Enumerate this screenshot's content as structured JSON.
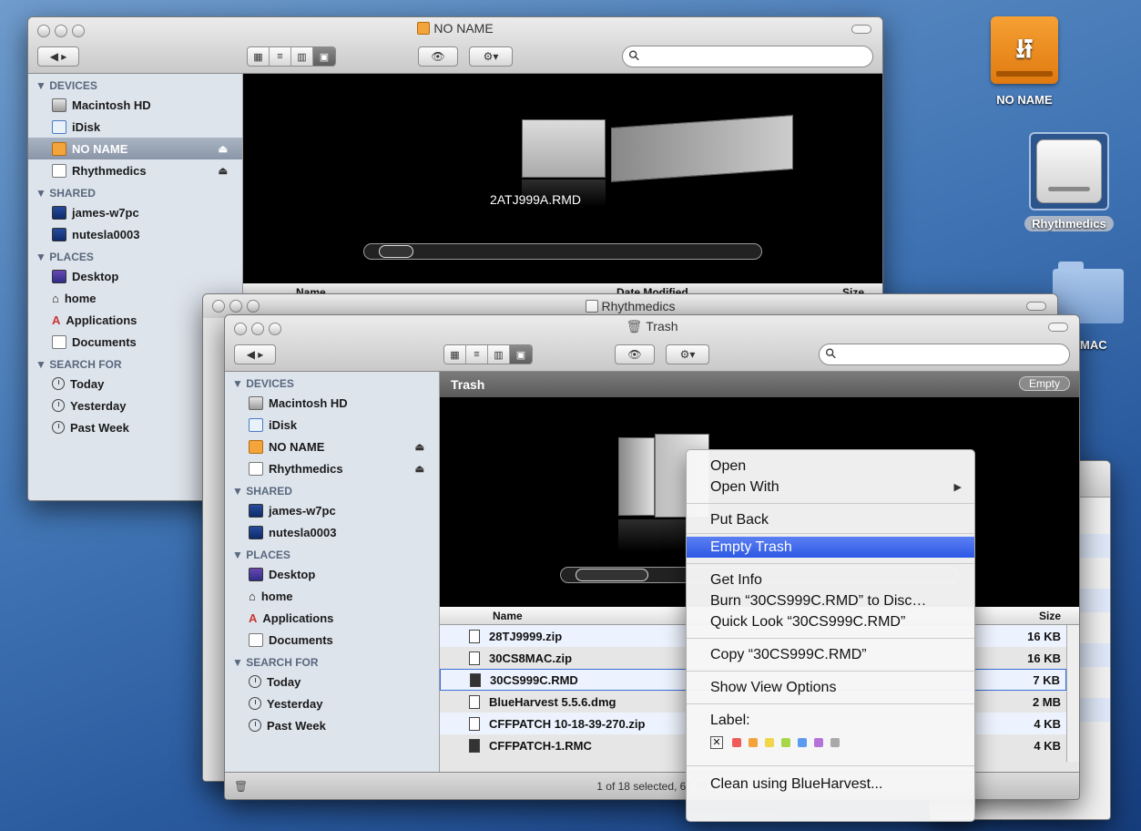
{
  "desktop": {
    "icons": [
      {
        "label": "NO NAME"
      },
      {
        "label": "Rhythmedics"
      },
      {
        "label": "MAC"
      }
    ]
  },
  "window_noname": {
    "title": "NO NAME",
    "coverflow_caption": "2ATJ999A.RMD",
    "columns": {
      "name": "Name",
      "date": "Date Modified",
      "size": "Size"
    },
    "sidebar": {
      "devices_header": "▼ DEVICES",
      "devices": [
        "Macintosh HD",
        "iDisk",
        "NO NAME",
        "Rhythmedics"
      ],
      "shared_header": "▼ SHARED",
      "shared": [
        "james-w7pc",
        "nutesla0003"
      ],
      "places_header": "▼ PLACES",
      "places": [
        "Desktop",
        "home",
        "Applications",
        "Documents"
      ],
      "search_header": "▼ SEARCH FOR",
      "search": [
        "Today",
        "Yesterday",
        "Past Week"
      ]
    }
  },
  "window_rhythmedics": {
    "title": "Rhythmedics"
  },
  "window_trash": {
    "title": "Trash",
    "path_label": "Trash",
    "empty_button": "Empty",
    "columns": {
      "name": "Name",
      "size": "Size"
    },
    "status": "1 of 18 selected, 67.59",
    "sidebar": {
      "devices_header": "▼ DEVICES",
      "devices": [
        "Macintosh HD",
        "iDisk",
        "NO NAME",
        "Rhythmedics"
      ],
      "shared_header": "▼ SHARED",
      "shared": [
        "james-w7pc",
        "nutesla0003"
      ],
      "places_header": "▼ PLACES",
      "places": [
        "Desktop",
        "home",
        "Applications",
        "Documents"
      ],
      "search_header": "▼ SEARCH FOR",
      "search": [
        "Today",
        "Yesterday",
        "Past Week"
      ]
    },
    "files": [
      {
        "name": "28TJ9999.zip",
        "size": "16 KB"
      },
      {
        "name": "30CS8MAC.zip",
        "size": "16 KB"
      },
      {
        "name": "30CS999C.RMD",
        "size": "7 KB"
      },
      {
        "name": "BlueHarvest 5.5.6.dmg",
        "size": "2 MB"
      },
      {
        "name": "CFFPATCH 10-18-39-270.zip",
        "size": "4 KB"
      },
      {
        "name": "CFFPATCH-1.RMC",
        "size": "4 KB"
      }
    ]
  },
  "context_menu": {
    "open": "Open",
    "open_with": "Open With",
    "put_back": "Put Back",
    "empty_trash": "Empty Trash",
    "get_info": "Get Info",
    "burn": "Burn “30CS999C.RMD” to Disc…",
    "quick_look": "Quick Look “30CS999C.RMD”",
    "copy": "Copy “30CS999C.RMD”",
    "show_view_options": "Show View Options",
    "label": "Label:",
    "label_colors": [
      "#f05a5a",
      "#f3a33a",
      "#f1d54a",
      "#a7d64a",
      "#5b9cf0",
      "#b373d8",
      "#a9a9a9"
    ],
    "clean": "Clean using BlueHarvest..."
  }
}
